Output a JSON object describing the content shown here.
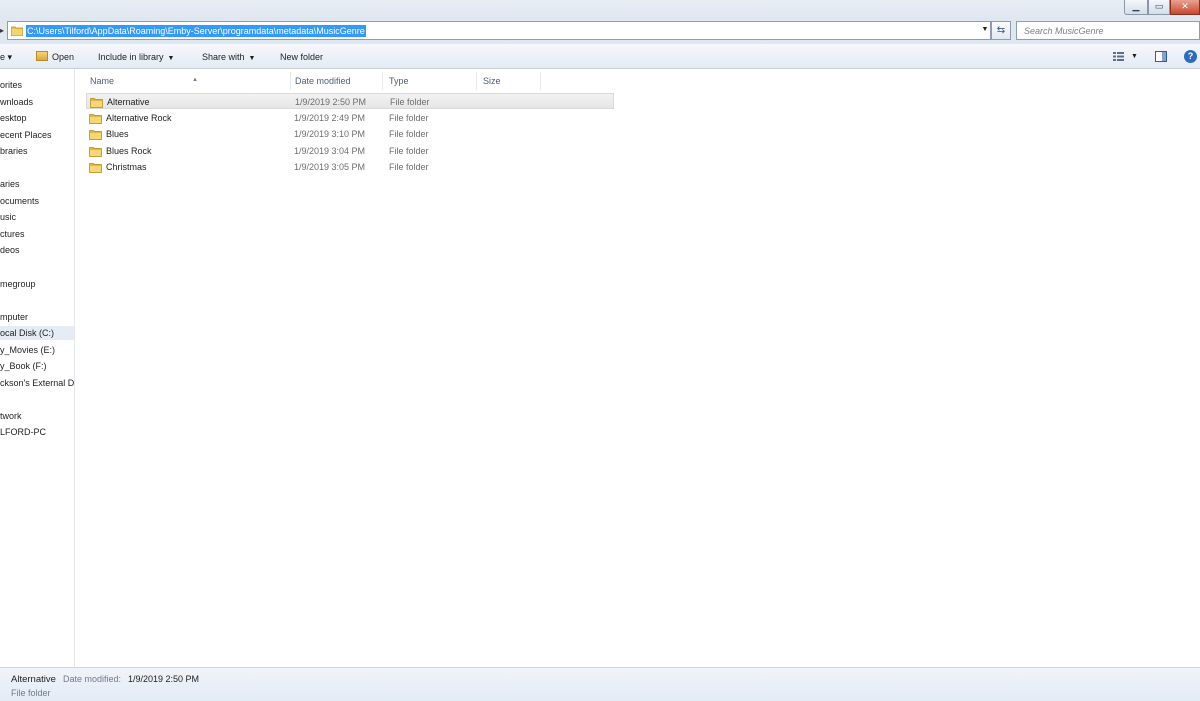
{
  "window": {
    "controls": {
      "minimize": "▁",
      "maximize": "▭",
      "close": "✕"
    }
  },
  "address": {
    "path": "C:\\Users\\Tilford\\AppData\\Roaming\\Emby-Server\\programdata\\metadata\\MusicGenre",
    "dropdown_glyph": "▼",
    "refresh_glyph": "⇆",
    "back_glyph": "▸"
  },
  "search": {
    "placeholder": "Search MusicGenre"
  },
  "toolbar": {
    "organize_arrow": "e ▾",
    "open": "Open",
    "include_in_library": "Include in library",
    "share_with": "Share with",
    "new_folder": "New folder",
    "dropdown_glyph": "▼",
    "help_glyph": "?"
  },
  "nav": {
    "items": [
      {
        "label": "orites",
        "selected": false
      },
      {
        "label": "wnloads",
        "selected": false
      },
      {
        "label": "esktop",
        "selected": false
      },
      {
        "label": "ecent Places",
        "selected": false
      },
      {
        "label": "braries",
        "selected": false
      },
      {
        "label": "aries",
        "selected": false
      },
      {
        "label": "ocuments",
        "selected": false
      },
      {
        "label": "usic",
        "selected": false
      },
      {
        "label": "ctures",
        "selected": false
      },
      {
        "label": "deos",
        "selected": false
      },
      {
        "label": "megroup",
        "selected": false
      },
      {
        "label": "mputer",
        "selected": false
      },
      {
        "label": "ocal Disk (C:)",
        "selected": true
      },
      {
        "label": "y_Movies (E:)",
        "selected": false
      },
      {
        "label": "y_Book (F:)",
        "selected": false
      },
      {
        "label": "ckson's External D",
        "selected": false
      },
      {
        "label": "twork",
        "selected": false
      },
      {
        "label": "LFORD-PC",
        "selected": false
      }
    ]
  },
  "columns": {
    "name": "Name",
    "date_modified": "Date modified",
    "type": "Type",
    "size": "Size",
    "sort_glyph": "▲"
  },
  "files": [
    {
      "name": "Alternative",
      "date": "1/9/2019 2:50 PM",
      "type": "File folder",
      "selected": true
    },
    {
      "name": "Alternative Rock",
      "date": "1/9/2019 2:49 PM",
      "type": "File folder",
      "selected": false
    },
    {
      "name": "Blues",
      "date": "1/9/2019 3:10 PM",
      "type": "File folder",
      "selected": false
    },
    {
      "name": "Blues Rock",
      "date": "1/9/2019 3:04 PM",
      "type": "File folder",
      "selected": false
    },
    {
      "name": "Christmas",
      "date": "1/9/2019 3:05 PM",
      "type": "File folder",
      "selected": false
    }
  ],
  "details": {
    "name": "Alternative",
    "date_label": "Date modified:",
    "date": "1/9/2019 2:50 PM",
    "type": "File folder"
  },
  "colors": {
    "selection_blue": "#3399ff",
    "folder_yellow": "#e8c04a",
    "chrome_bg": "#dfe7f1"
  }
}
